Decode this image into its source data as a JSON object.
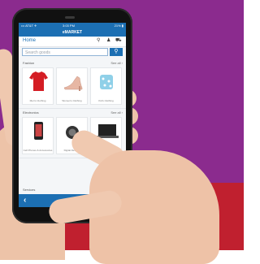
{
  "status_bar": {
    "carrier": "••• AT&T ✈",
    "time": "3:03 PM",
    "battery": "21% ▮"
  },
  "app": {
    "title": "eMARKET"
  },
  "home": {
    "label": "Home",
    "icons": {
      "search": "search-icon",
      "user": "user-icon",
      "cart": "cart-icon"
    }
  },
  "search": {
    "placeholder": "Search goods"
  },
  "sections": {
    "fashion": {
      "title": "Fashion",
      "see_all": "See all ›",
      "items": [
        {
          "label": "Men's Clothing",
          "icon": "red-shirt-icon"
        },
        {
          "label": "Women's Clothing",
          "icon": "high-heel-shoe-icon"
        },
        {
          "label": "Kid's Clothing",
          "icon": "kids-clothes-icon"
        }
      ]
    },
    "electronics": {
      "title": "Electronics",
      "see_all": "See all ›",
      "items": [
        {
          "label": "Cell Phones & Accessories",
          "icon": "smartphone-icon"
        },
        {
          "label": "Digital Devices",
          "icon": "digital-camera-icon"
        },
        {
          "label": "",
          "icon": "laptop-icon"
        }
      ]
    },
    "third": {
      "title": "Services",
      "see_all": "See all ›"
    }
  },
  "nav": {
    "prev": "‹",
    "next": "›"
  },
  "colors": {
    "primary": "#1c6fb3",
    "background_purple": "#8b2b8e",
    "background_red": "#c0202f"
  }
}
